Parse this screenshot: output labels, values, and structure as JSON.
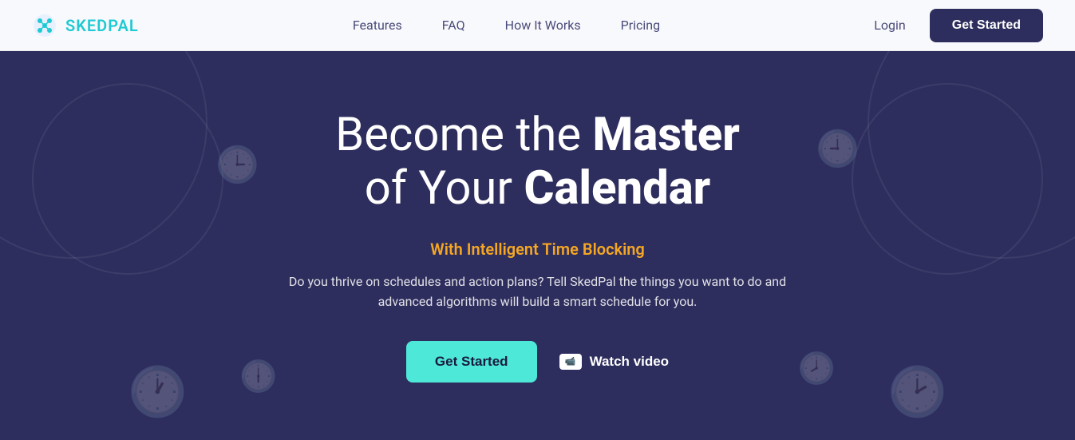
{
  "navbar": {
    "logo_text_light": "SKED",
    "logo_text_bold": "PAL",
    "nav_links": [
      {
        "label": "Features",
        "id": "features"
      },
      {
        "label": "FAQ",
        "id": "faq"
      },
      {
        "label": "How It Works",
        "id": "how-it-works"
      },
      {
        "label": "Pricing",
        "id": "pricing"
      }
    ],
    "login_label": "Login",
    "get_started_label": "Get Started"
  },
  "hero": {
    "title_line1": "Become the",
    "title_bold1": "Master",
    "title_line2": "of Your",
    "title_bold2": "Calendar",
    "subtitle": "With Intelligent Time Blocking",
    "description": "Do you thrive on schedules and action plans? Tell SkedPal\nthe things you want to do and advanced algorithms will\nbuild a smart schedule for you.",
    "get_started_label": "Get Started",
    "watch_video_label": "Watch video"
  },
  "colors": {
    "hero_bg": "#2e2e5e",
    "accent_teal": "#4de8d8",
    "accent_orange": "#f5a623",
    "nav_bg": "#f8f9fc",
    "dark_navy": "#2d2d5e"
  }
}
